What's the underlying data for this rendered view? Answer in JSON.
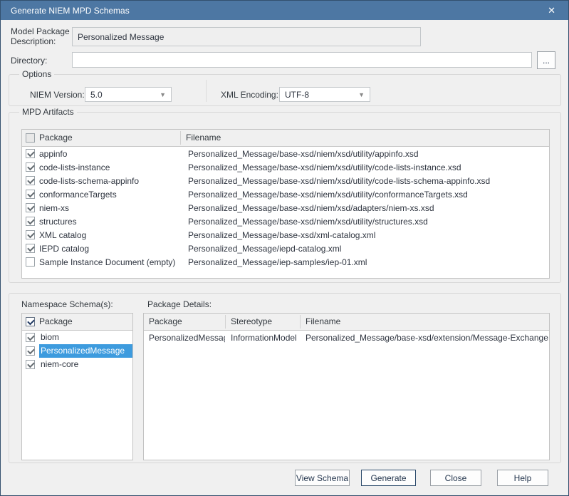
{
  "window": {
    "title": "Generate NIEM MPD Schemas"
  },
  "icons": {
    "close": "✕",
    "dropdown_arrow": "▼",
    "browse": "..."
  },
  "colors": {
    "titlebar": "#4d77a3",
    "window_border": "#33506e",
    "selection": "#3d9bde"
  },
  "fields": {
    "model_package_description": {
      "label": "Model Package Description:",
      "value": "Personalized Message"
    },
    "directory": {
      "label": "Directory:",
      "value": ""
    }
  },
  "options": {
    "title": "Options",
    "niem_version": {
      "label": "NIEM Version:",
      "value": "5.0"
    },
    "xml_encoding": {
      "label": "XML Encoding:",
      "value": "UTF-8"
    }
  },
  "mpd_artifacts": {
    "title": "MPD Artifacts",
    "columns": [
      "Package",
      "Filename"
    ],
    "header_checkbox_checked": false,
    "rows": [
      {
        "checked": true,
        "package": "appinfo",
        "filename": "Personalized_Message/base-xsd/niem/xsd/utility/appinfo.xsd"
      },
      {
        "checked": true,
        "package": "code-lists-instance",
        "filename": "Personalized_Message/base-xsd/niem/xsd/utility/code-lists-instance.xsd"
      },
      {
        "checked": true,
        "package": "code-lists-schema-appinfo",
        "filename": "Personalized_Message/base-xsd/niem/xsd/utility/code-lists-schema-appinfo.xsd"
      },
      {
        "checked": true,
        "package": "conformanceTargets",
        "filename": "Personalized_Message/base-xsd/niem/xsd/utility/conformanceTargets.xsd"
      },
      {
        "checked": true,
        "package": "niem-xs",
        "filename": "Personalized_Message/base-xsd/niem/xsd/adapters/niem-xs.xsd"
      },
      {
        "checked": true,
        "package": "structures",
        "filename": "Personalized_Message/base-xsd/niem/xsd/utility/structures.xsd"
      },
      {
        "checked": true,
        "package": "XML catalog",
        "filename": "Personalized_Message/base-xsd/xml-catalog.xml"
      },
      {
        "checked": true,
        "package": "IEPD catalog",
        "filename": "Personalized_Message/iepd-catalog.xml"
      },
      {
        "checked": false,
        "package": "Sample Instance Document (empty)",
        "filename": "Personalized_Message/iep-samples/iep-01.xml"
      }
    ]
  },
  "namespace_schemas": {
    "label": "Namespace Schema(s):",
    "header": "Package",
    "header_checkbox_checked": true,
    "items": [
      {
        "checked": true,
        "label": "biom",
        "selected": false
      },
      {
        "checked": true,
        "label": "PersonalizedMessage",
        "selected": true
      },
      {
        "checked": true,
        "label": "niem-core",
        "selected": false
      }
    ]
  },
  "package_details": {
    "label": "Package Details:",
    "columns": [
      "Package",
      "Stereotype",
      "Filename"
    ],
    "rows": [
      {
        "package": "PersonalizedMessage",
        "stereotype": "InformationModel",
        "filename": "Personalized_Message/base-xsd/extension/Message-Exchange.xsd"
      }
    ]
  },
  "buttons": {
    "view_schema": "View Schema",
    "generate": "Generate",
    "close": "Close",
    "help": "Help"
  }
}
